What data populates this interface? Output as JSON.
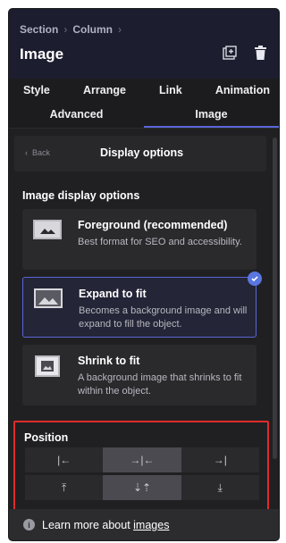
{
  "breadcrumb": [
    "Section",
    "Column"
  ],
  "title": "Image",
  "header_icons": [
    "add-image-icon",
    "trash-icon"
  ],
  "tabs_row1": [
    "Style",
    "Arrange",
    "Link",
    "Animation"
  ],
  "tabs_row2": [
    "Advanced",
    "Image"
  ],
  "active_tab": "Image",
  "back_label": "Back",
  "display_title": "Display options",
  "section_title": "Image display options",
  "options": [
    {
      "title": "Foreground (recommended)",
      "desc": "Best format for SEO and accessibility.",
      "selected": false
    },
    {
      "title": "Expand to fit",
      "desc": "Becomes a background image and will expand to fill the object.",
      "selected": true
    },
    {
      "title": "Shrink to fit",
      "desc": "A background image that shrinks to fit within the object.",
      "selected": false
    }
  ],
  "position": {
    "title": "Position",
    "row1": [
      "|←",
      "→|←",
      "→|"
    ],
    "row2": [
      "⤒",
      "⇣⇡",
      "⤓"
    ],
    "active_col": 1
  },
  "footer": {
    "text": "Learn more about ",
    "link": "images"
  },
  "colors": {
    "accent": "#5966d8",
    "highlight_border": "#e02b2b"
  }
}
